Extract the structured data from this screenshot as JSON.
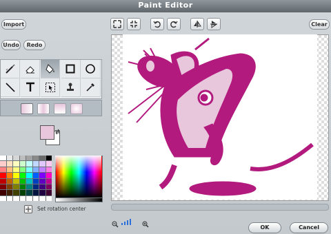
{
  "window": {
    "title": "Paint Editor"
  },
  "toolbar": {
    "import_label": "Import",
    "undo_label": "Undo",
    "redo_label": "Redo",
    "clear_label": "Clear",
    "icons": [
      "grow-icon",
      "shrink-icon",
      "rotate-left-icon",
      "rotate-right-icon",
      "flip-horizontal-icon",
      "flip-vertical-icon"
    ]
  },
  "tools": [
    "paintbrush",
    "eraser",
    "fill",
    "rectangle",
    "ellipse",
    "line",
    "text",
    "select",
    "stamp",
    "eyedropper"
  ],
  "selected_tool": "fill",
  "colors": {
    "foreground": "#e8c6dc",
    "background": "#ffffff",
    "accent": "#b31a7e",
    "palette": [
      "#ffffff",
      "#e8e8e8",
      "#d6d6d6",
      "#bdbdbd",
      "#a3a3a3",
      "#8a8a8a",
      "#6b6b6b",
      "#000000",
      "#ffcccc",
      "#ffe0c0",
      "#ffffc0",
      "#ccffcc",
      "#c0ffff",
      "#c0d8ff",
      "#e0c8ff",
      "#ffc8f0",
      "#ff8080",
      "#ffc080",
      "#ffff80",
      "#80ff80",
      "#80ffff",
      "#80b0ff",
      "#c080ff",
      "#ff80e0",
      "#ff0000",
      "#ff8000",
      "#ffff00",
      "#00ff00",
      "#00ffff",
      "#0060ff",
      "#8000ff",
      "#ff00c0",
      "#c00000",
      "#c06000",
      "#c0c000",
      "#00c000",
      "#00c0c0",
      "#0040c0",
      "#6000c0",
      "#c00090",
      "#800000",
      "#804000",
      "#808000",
      "#008000",
      "#008080",
      "#002880",
      "#400080",
      "#800060",
      "#400000",
      "#402000",
      "#404000",
      "#004000",
      "#004040",
      "#001440",
      "#200040",
      "#400030",
      "#ffffff",
      "#ffffff",
      "#ffffff",
      "#ffffff",
      "#ffffff",
      "#ffffff",
      "#ffffff",
      "#ffffff"
    ]
  },
  "rotation_label": "Set rotation center",
  "actions": {
    "ok_label": "OK",
    "cancel_label": "Cancel"
  }
}
